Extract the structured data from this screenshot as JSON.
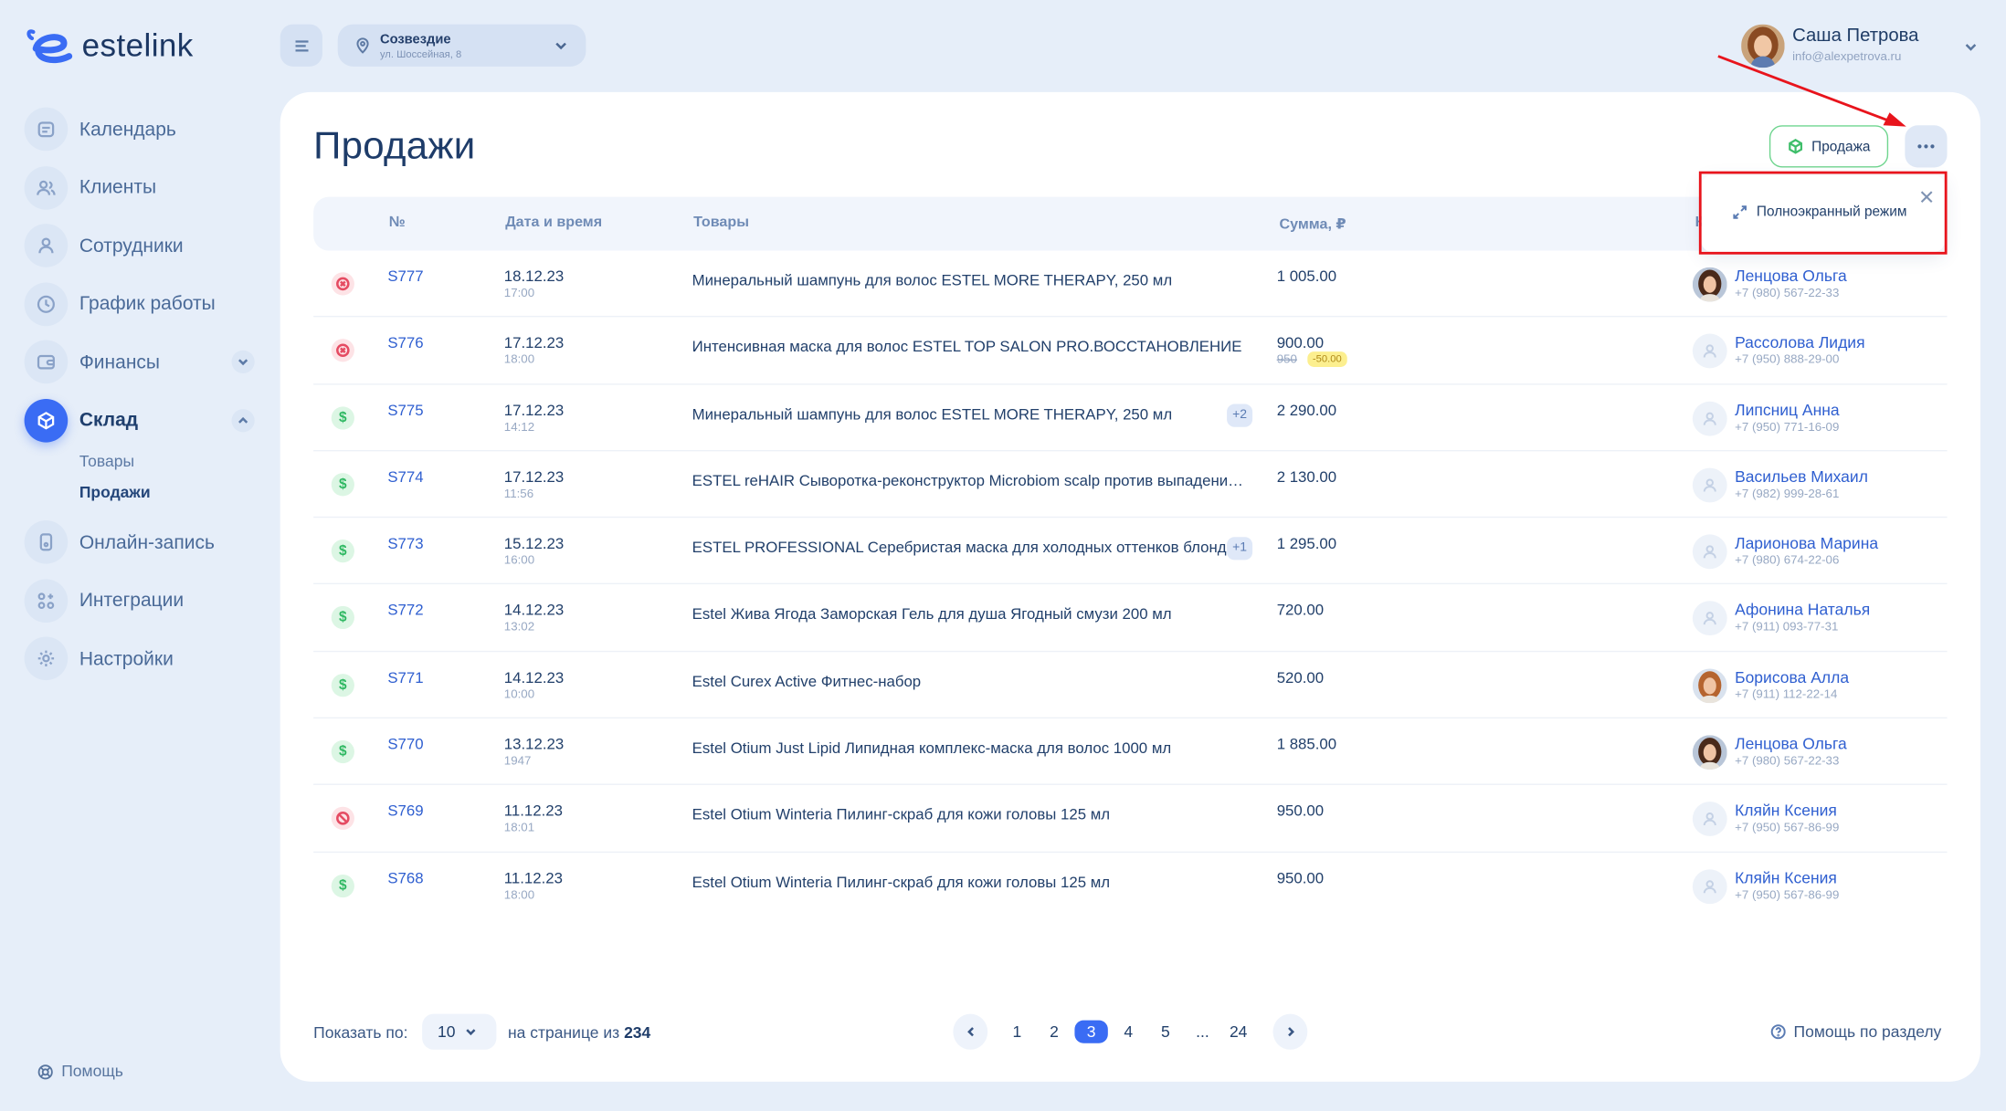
{
  "app": {
    "logo_text": "estelink"
  },
  "sidebar": {
    "items": [
      {
        "label": "Календарь",
        "icon": "calendar-icon"
      },
      {
        "label": "Клиенты",
        "icon": "clients-icon"
      },
      {
        "label": "Сотрудники",
        "icon": "staff-icon"
      },
      {
        "label": "График работы",
        "icon": "clock-icon"
      },
      {
        "label": "Финансы",
        "icon": "wallet-icon"
      },
      {
        "label": "Склад",
        "icon": "warehouse-icon"
      },
      {
        "label": "Онлайн-запись",
        "icon": "phone-icon"
      },
      {
        "label": "Интеграции",
        "icon": "integrations-icon"
      },
      {
        "label": "Настройки",
        "icon": "gear-icon"
      }
    ],
    "sub_items": [
      "Товары",
      "Продажи"
    ],
    "help": "Помощь"
  },
  "header": {
    "branch_name": "Созвездие",
    "branch_address": "ул. Шоссейная, 8",
    "user_name": "Саша Петрова",
    "user_email": "info@alexpetrova.ru"
  },
  "page": {
    "title": "Продажи",
    "sale_button": "Продажа",
    "popup_item": "Полноэкранный режим"
  },
  "table": {
    "columns": [
      "№",
      "Дата и время",
      "Товары",
      "Сумма, ₽",
      "К"
    ],
    "rows": [
      {
        "status": "cancelled",
        "num": "S777",
        "date": "18.12.23",
        "time": "17:00",
        "goods": "Минеральный шампунь для волос ESTEL MORE THERAPY, 250 мл",
        "extra": "",
        "sum": "1 005.00",
        "sum_old": "",
        "discount": "",
        "client": "Ленцова Ольга",
        "phone": "+7 (980) 567-22-33",
        "photo": "a"
      },
      {
        "status": "cancelled",
        "num": "S776",
        "date": "17.12.23",
        "time": "18:00",
        "goods": "Интенсивная маска для волос ESTEL TOP SALON PRO.ВОССТАНОВЛЕНИЕ",
        "extra": "",
        "sum": "900.00",
        "sum_old": "950",
        "discount": "-50.00",
        "client": "Рассолова Лидия",
        "phone": "+7 (950) 888-29-00",
        "photo": ""
      },
      {
        "status": "paid",
        "num": "S775",
        "date": "17.12.23",
        "time": "14:12",
        "goods": "Минеральный шампунь для волос ESTEL MORE THERAPY, 250 мл",
        "extra": "+2",
        "sum": "2 290.00",
        "sum_old": "",
        "discount": "",
        "client": "Липсниц Анна",
        "phone": "+7 (950) 771-16-09",
        "photo": ""
      },
      {
        "status": "paid",
        "num": "S774",
        "date": "17.12.23",
        "time": "11:56",
        "goods": "ESTEL reHAIR Сыворотка-реконструктор Microbiom scalp против выпадения волос",
        "extra": "",
        "sum": "2 130.00",
        "sum_old": "",
        "discount": "",
        "client": "Васильев Михаил",
        "phone": "+7 (982) 999-28-61",
        "photo": ""
      },
      {
        "status": "paid",
        "num": "S773",
        "date": "15.12.23",
        "time": "16:00",
        "goods": "ESTEL PROFESSIONAL Серебристая маска для холодных оттенков блонд",
        "extra": "+1",
        "sum": "1 295.00",
        "sum_old": "",
        "discount": "",
        "client": "Ларионова Марина",
        "phone": "+7 (980) 674-22-06",
        "photo": ""
      },
      {
        "status": "paid",
        "num": "S772",
        "date": "14.12.23",
        "time": "13:02",
        "goods": "Estel Жива Ягода Заморская Гель для душа Ягодный смузи 200 мл",
        "extra": "",
        "sum": "720.00",
        "sum_old": "",
        "discount": "",
        "client": "Афонина Наталья",
        "phone": "+7 (911) 093-77-31",
        "photo": ""
      },
      {
        "status": "paid",
        "num": "S771",
        "date": "14.12.23",
        "time": "10:00",
        "goods": "Estel Curex Active Фитнес-набор",
        "extra": "",
        "sum": "520.00",
        "sum_old": "",
        "discount": "",
        "client": "Борисова Алла",
        "phone": "+7 (911) 112-22-14",
        "photo": "b"
      },
      {
        "status": "paid",
        "num": "S770",
        "date": "13.12.23",
        "time": "1947",
        "goods": "Estel Otium Just Lipid Липидная комплекс-маска для волос 1000 мл",
        "extra": "",
        "sum": "1 885.00",
        "sum_old": "",
        "discount": "",
        "client": "Ленцова Ольга",
        "phone": "+7 (980) 567-22-33",
        "photo": "a"
      },
      {
        "status": "void",
        "num": "S769",
        "date": "11.12.23",
        "time": "18:01",
        "goods": "Estel Otium Winteria Пилинг-скраб для кожи головы 125 мл",
        "extra": "",
        "sum": "950.00",
        "sum_old": "",
        "discount": "",
        "client": "Кляйн Ксения",
        "phone": "+7 (950) 567-86-99",
        "photo": ""
      },
      {
        "status": "paid",
        "num": "S768",
        "date": "11.12.23",
        "time": "18:00",
        "goods": "Estel Otium Winteria Пилинг-скраб для кожи головы 125 мл",
        "extra": "",
        "sum": "950.00",
        "sum_old": "",
        "discount": "",
        "client": "Кляйн Ксения",
        "phone": "+7 (950) 567-86-99",
        "photo": ""
      }
    ]
  },
  "footer": {
    "show_label": "Показать по:",
    "per_page": "10",
    "page_of_label": "на странице из",
    "total": "234",
    "pages": [
      "1",
      "2",
      "3",
      "4",
      "5",
      "...",
      "24"
    ],
    "current_page": "3",
    "help_section": "Помощь по разделу"
  },
  "colors": {
    "accent": "#3a6cf4",
    "annotation": "#e8141c",
    "paid": "#2fb862",
    "cancelled": "#e54b62"
  }
}
